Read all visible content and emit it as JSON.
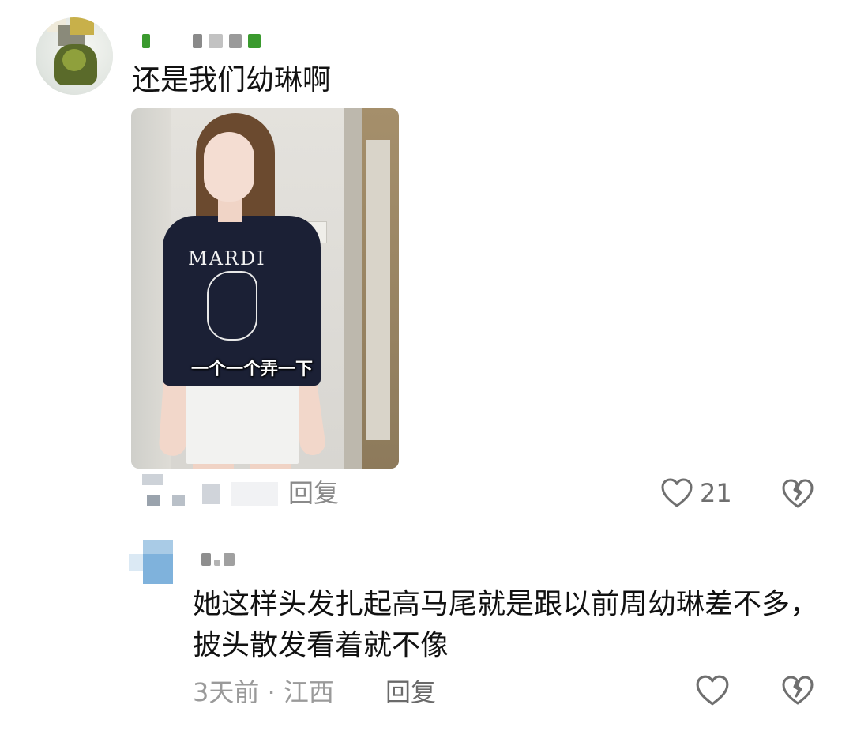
{
  "comments": [
    {
      "text": "还是我们幼琳啊",
      "image_caption": "一个一个弄一下",
      "shirt_print": "MARDI",
      "reply_label": "回复",
      "like_count": "21"
    },
    {
      "text": "她这样头发扎起高马尾就是跟以前周幼琳差不多，披头散发看着就不像",
      "meta": "3天前 · 江西",
      "reply_label": "回复"
    }
  ],
  "colors": {
    "text_primary": "#111111",
    "meta_gray": "#9a9a9a",
    "icon_gray": "#6f6f6f"
  },
  "icons": [
    "heart-outline-icon",
    "broken-heart-icon"
  ]
}
